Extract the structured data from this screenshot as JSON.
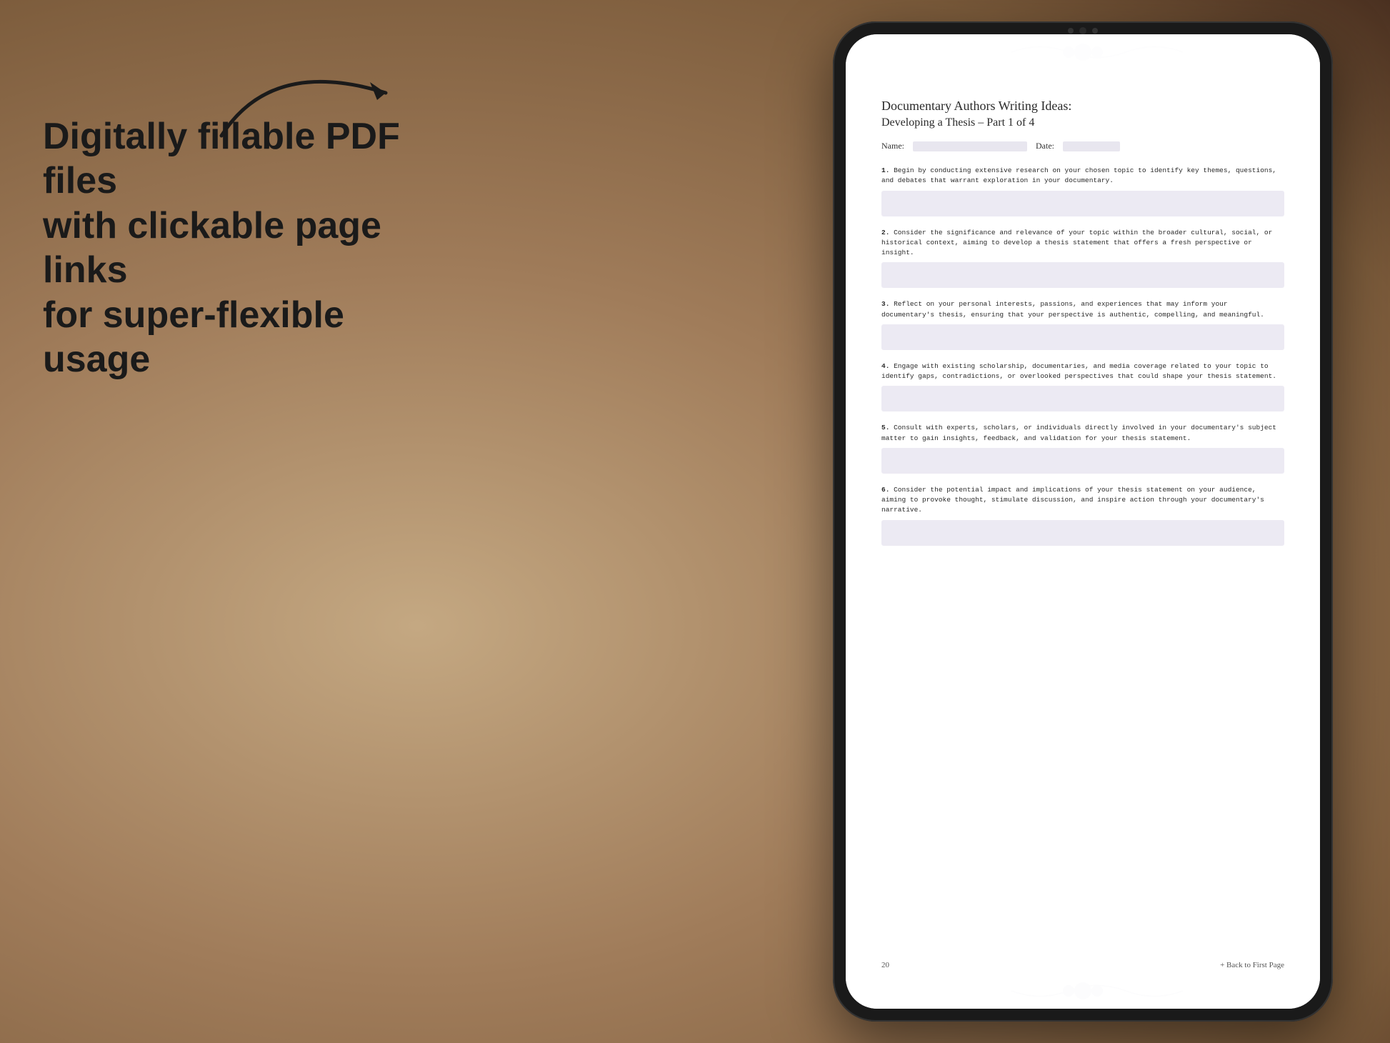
{
  "background": {
    "color": "#b89a7a"
  },
  "left_panel": {
    "main_text": "Digitally fillable PDF files\nwith clickable page links\nfor super-flexible usage"
  },
  "arrow": {
    "description": "curved arrow pointing right toward tablet"
  },
  "tablet": {
    "camera_dots": 3,
    "screen_bg": "#f5f4f8"
  },
  "pdf": {
    "title": "Documentary Authors Writing Ideas:",
    "subtitle": "Developing a Thesis – Part 1 of 4",
    "name_label": "Name:",
    "date_label": "Date:",
    "items": [
      {
        "number": "1.",
        "text": "Begin by conducting extensive research on your chosen topic to identify key themes, questions, and debates that warrant exploration in your documentary."
      },
      {
        "number": "2.",
        "text": "Consider the significance and relevance of your topic within the broader cultural, social, or historical context, aiming to develop a thesis statement that offers a fresh perspective or insight."
      },
      {
        "number": "3.",
        "text": "Reflect on your personal interests, passions, and experiences that may inform your documentary's thesis, ensuring that your perspective is authentic, compelling, and meaningful."
      },
      {
        "number": "4.",
        "text": "Engage with existing scholarship, documentaries, and media coverage related to your topic to identify gaps, contradictions, or overlooked perspectives that could shape your thesis statement."
      },
      {
        "number": "5.",
        "text": "Consult with experts, scholars, or individuals directly involved in your documentary's subject matter to gain insights, feedback, and validation for your thesis statement."
      },
      {
        "number": "6.",
        "text": "Consider the potential impact and implications of your thesis statement on your audience, aiming to provoke thought, stimulate discussion, and inspire action through your documentary's narrative."
      }
    ],
    "page_number": "20",
    "back_link": "+ Back to First Page"
  }
}
